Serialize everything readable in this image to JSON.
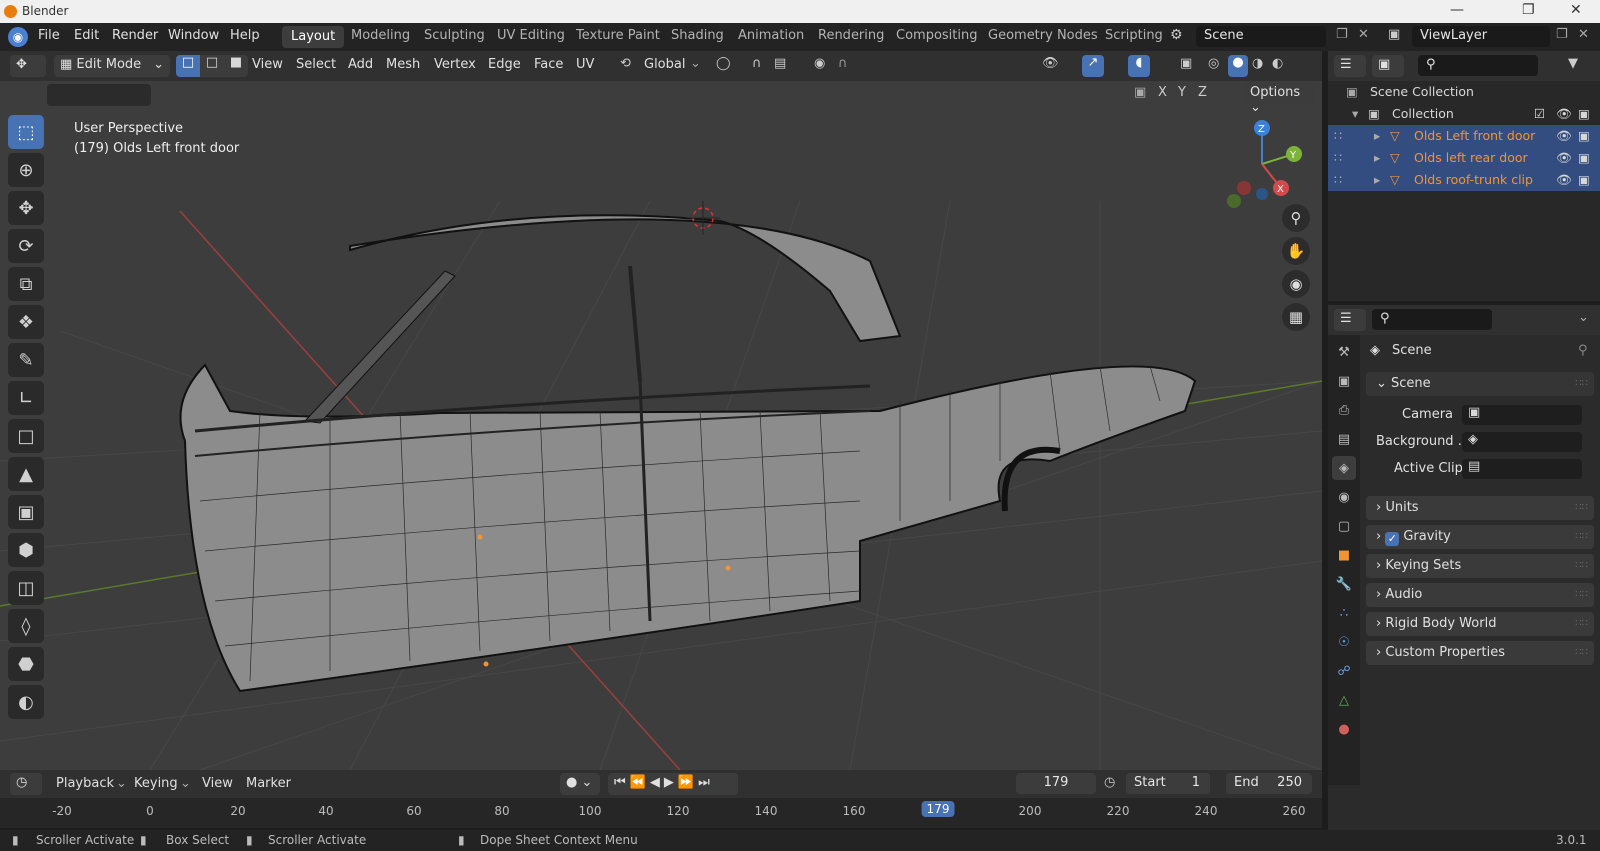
{
  "window": {
    "title": "Blender"
  },
  "menu": [
    "File",
    "Edit",
    "Render",
    "Window",
    "Help"
  ],
  "workspaces": [
    "Layout",
    "Modeling",
    "Sculpting",
    "UV Editing",
    "Texture Paint",
    "Shading",
    "Animation",
    "Rendering",
    "Compositing",
    "Geometry Nodes",
    "Scripting"
  ],
  "scene_field": "Scene",
  "viewlayer_field": "ViewLayer",
  "header3d": {
    "mode": "Edit Mode",
    "menus": [
      "View",
      "Select",
      "Add",
      "Mesh",
      "Vertex",
      "Edge",
      "Face",
      "UV"
    ],
    "transform": "Global",
    "options": "Options",
    "axes": [
      "X",
      "Y",
      "Z"
    ]
  },
  "viewport": {
    "perspective": "User Perspective",
    "object_info": "(179) Olds Left front door",
    "gizmo": {
      "x": "X",
      "y": "Y",
      "z": "Z"
    }
  },
  "outliner": {
    "scene_collection": "Scene Collection",
    "collection": "Collection",
    "objects": [
      "Olds Left front door",
      "Olds left rear door",
      "Olds roof-trunk clip l"
    ]
  },
  "properties": {
    "context": "Scene",
    "panel_scene": "Scene",
    "camera_label": "Camera",
    "background_label": "Background ...",
    "active_clip_label": "Active Clip",
    "panels": [
      "Units",
      "Gravity",
      "Keying Sets",
      "Audio",
      "Rigid Body World",
      "Custom Properties"
    ]
  },
  "timeline": {
    "menus": [
      "Playback",
      "Keying",
      "View",
      "Marker"
    ],
    "current_frame": "179",
    "start_label": "Start",
    "start": "1",
    "end_label": "End",
    "end": "250",
    "ticks": [
      "-20",
      "0",
      "20",
      "40",
      "60",
      "80",
      "100",
      "120",
      "140",
      "160",
      "179",
      "200",
      "220",
      "240",
      "260"
    ]
  },
  "status": {
    "items": [
      "Scroller Activate",
      "Box Select",
      "Scroller Activate",
      "Dope Sheet Context Menu"
    ],
    "version": "3.0.1"
  },
  "colors": {
    "accent": "#4772b3",
    "selected_object": "#f29433",
    "viewport_bg": "#3d3d3d"
  }
}
